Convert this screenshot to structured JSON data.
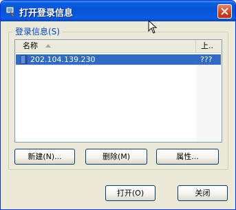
{
  "window": {
    "title": "打开登录信息"
  },
  "group": {
    "label": "登录信息(S)"
  },
  "list": {
    "columns": [
      "名称",
      "上.."
    ],
    "rows": [
      {
        "name": "202.104.139.230",
        "upload": "???"
      }
    ]
  },
  "buttons": {
    "new": "新建(N)...",
    "delete": "删除(M)",
    "properties": "属性...",
    "open": "打开(O)",
    "close": "关闭"
  },
  "colors": {
    "title_bar": "#0553d6",
    "selection": "#316ac5",
    "group_label": "#0046d5",
    "close_button": "#d0401c"
  }
}
